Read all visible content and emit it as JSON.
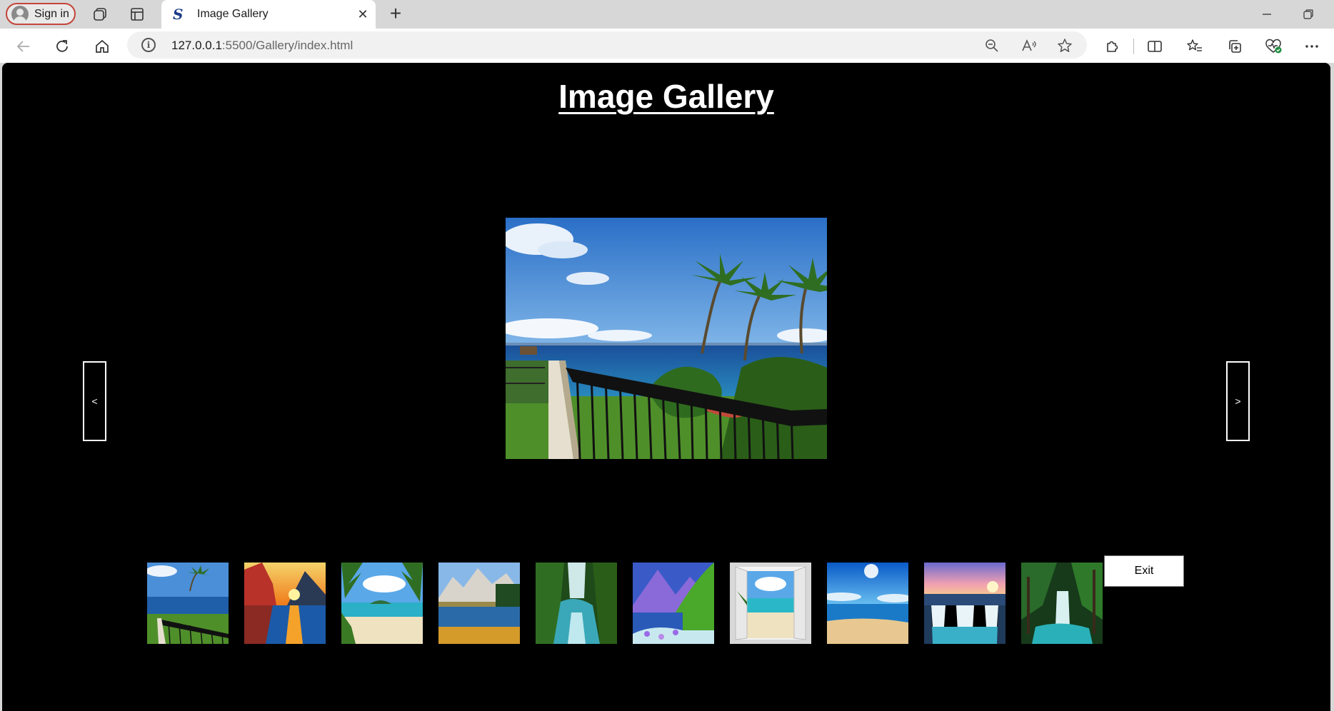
{
  "browser": {
    "signin_label": "Sign in",
    "tab_title": "Image Gallery",
    "url_host": "127.0.0.1",
    "url_rest": ":5500/Gallery/index.html",
    "accent": "#c4453a"
  },
  "page": {
    "title": "Image Gallery",
    "prev_label": "<",
    "next_label": ">",
    "exit_label": "Exit",
    "background": "#000000"
  },
  "gallery": {
    "main_image": "tropical-balcony-ocean",
    "thumbnails": [
      "tropical-balcony-ocean",
      "mountain-sunset-lake",
      "palm-beach-island",
      "alpine-lake-reflection",
      "forest-waterfall",
      "purple-mountain-meadow",
      "window-beach-view",
      "blue-ocean-beach",
      "sunset-waterfalls",
      "jungle-waterfall"
    ]
  }
}
